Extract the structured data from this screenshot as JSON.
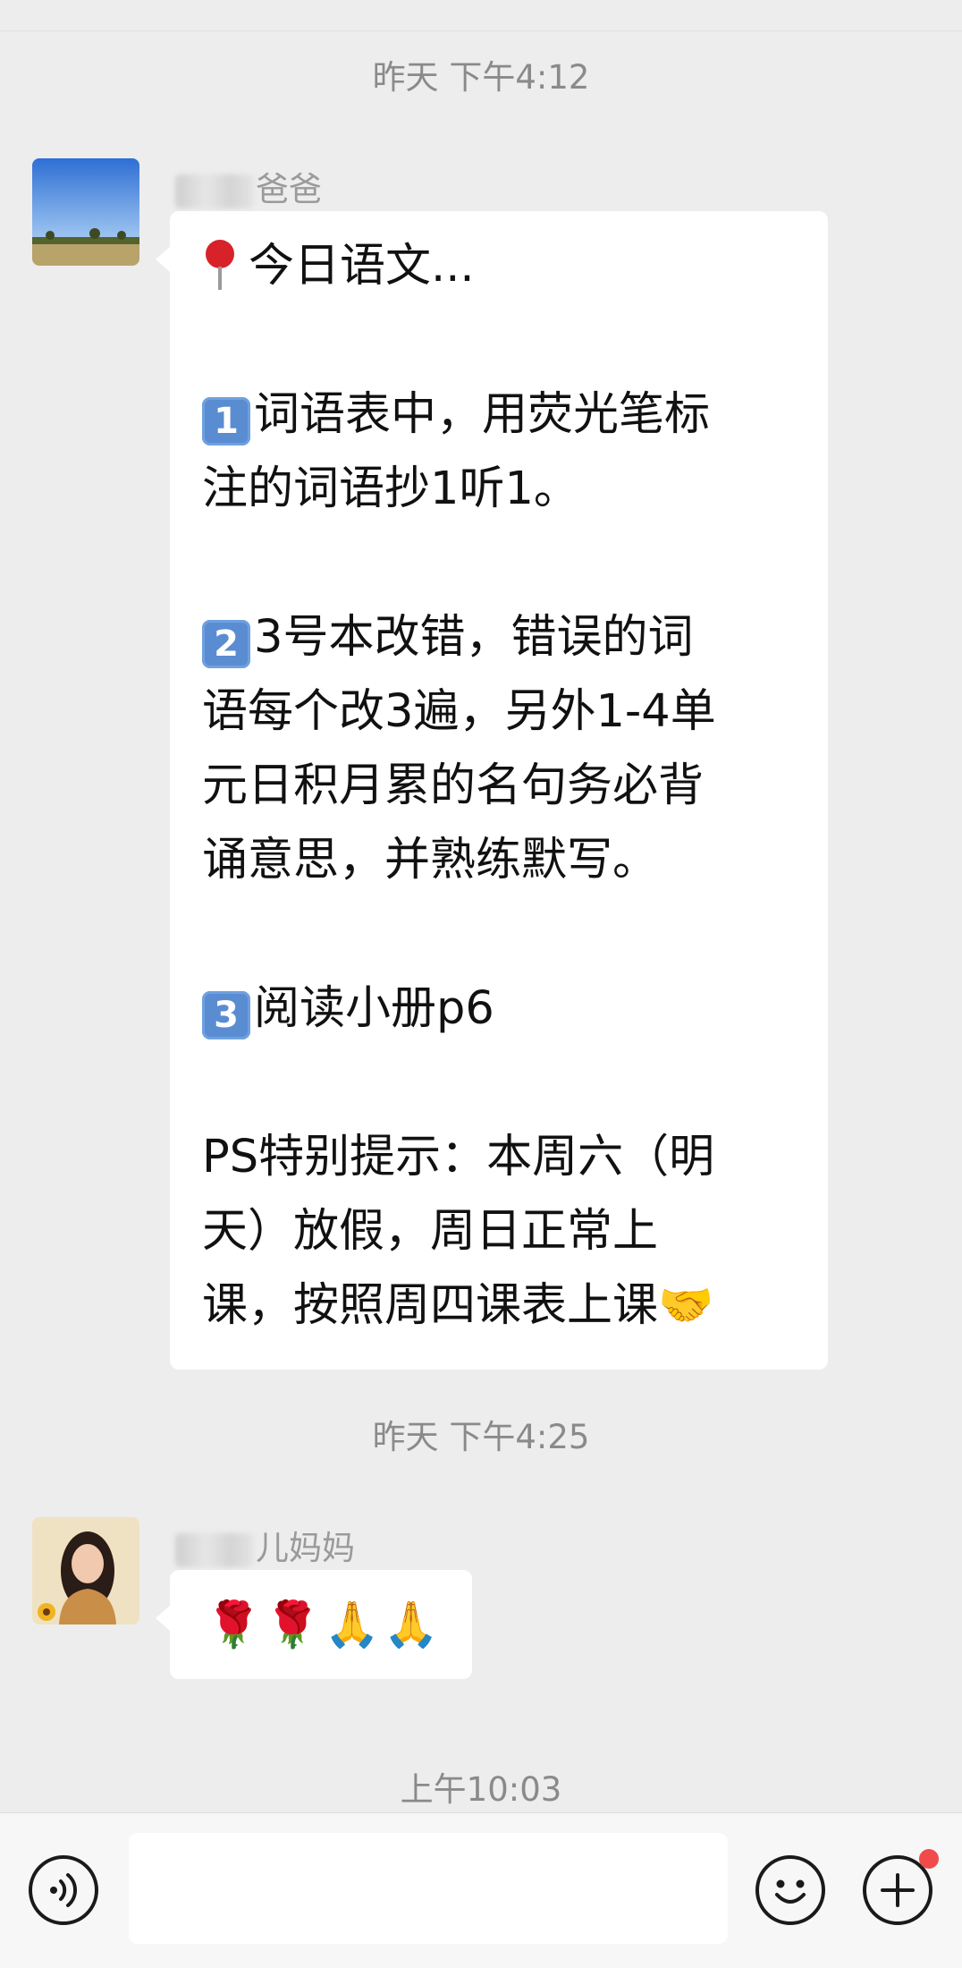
{
  "chat": {
    "messages": [
      {
        "timestamp": "昨天 下午4:12",
        "sender_suffix": "爸爸",
        "lines": {
          "title": "今日语文...",
          "item1_num": "1",
          "item1_a": "词语表中，用荧光笔标",
          "item1_b": "注的词语抄1听1。",
          "item2_num": "2",
          "item2_a": "3号本改错，错误的词",
          "item2_b": "语每个改3遍，另外1-4单",
          "item2_c": "元日积月累的名句务必背",
          "item2_d": "诵意思，并熟练默写。",
          "item3_num": "3",
          "item3_a": "阅读小册p6",
          "ps_a": "PS特别提示：本周六（明",
          "ps_b": "天）放假，周日正常上",
          "ps_c": "课，按照周四课表上课",
          "ps_emoji": "🤝"
        }
      },
      {
        "timestamp": "昨天 下午4:25",
        "sender_suffix": "儿妈妈",
        "content": "🌹🌹🙏🙏"
      },
      {
        "timestamp": "上午10:03"
      }
    ]
  },
  "toolbar": {
    "voice_icon": "voice-icon",
    "emoji_icon": "emoji-icon",
    "plus_icon": "plus-icon",
    "badge_color": "#f04a4a"
  },
  "colors": {
    "background": "#ededed",
    "bubble": "#ffffff",
    "timestamp": "#8a8a8a"
  }
}
